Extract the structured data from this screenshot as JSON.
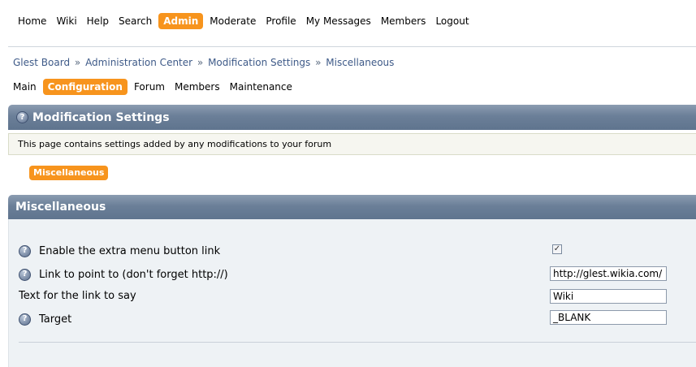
{
  "topnav": {
    "items": [
      {
        "label": "Home"
      },
      {
        "label": "Wiki"
      },
      {
        "label": "Help"
      },
      {
        "label": "Search"
      },
      {
        "label": "Admin"
      },
      {
        "label": "Moderate"
      },
      {
        "label": "Profile"
      },
      {
        "label": "My Messages"
      },
      {
        "label": "Members"
      },
      {
        "label": "Logout"
      }
    ],
    "active_label": "Admin"
  },
  "breadcrumb": [
    "Glest Board",
    "Administration Center",
    "Modification Settings",
    "Miscellaneous"
  ],
  "breadcrumb_separator": "»",
  "subnav": {
    "items": [
      {
        "label": "Main"
      },
      {
        "label": "Configuration"
      },
      {
        "label": "Forum"
      },
      {
        "label": "Members"
      },
      {
        "label": "Maintenance"
      }
    ],
    "active_label": "Configuration"
  },
  "header": {
    "title": "Modification Settings",
    "description": "This page contains settings added by any modifications to your forum"
  },
  "tab": {
    "label": "Miscellaneous"
  },
  "section": {
    "title": "Miscellaneous"
  },
  "help_glyph": "?",
  "settings": [
    {
      "label": "Enable the extra menu button link",
      "type": "checkbox",
      "checked": true,
      "check_glyph": "✓"
    },
    {
      "label": "Link to point to (don't forget http://)",
      "type": "text",
      "value": "http://glest.wikia.com/"
    },
    {
      "label": "Text for the link to say",
      "type": "text",
      "value": "Wiki"
    },
    {
      "label": "Target",
      "type": "text",
      "value": "_BLANK"
    }
  ],
  "colors": {
    "accent": "#f7941d",
    "header_bar": "#6b7f98",
    "link": "#3e5a88",
    "panel_bg": "#eef2f5"
  }
}
